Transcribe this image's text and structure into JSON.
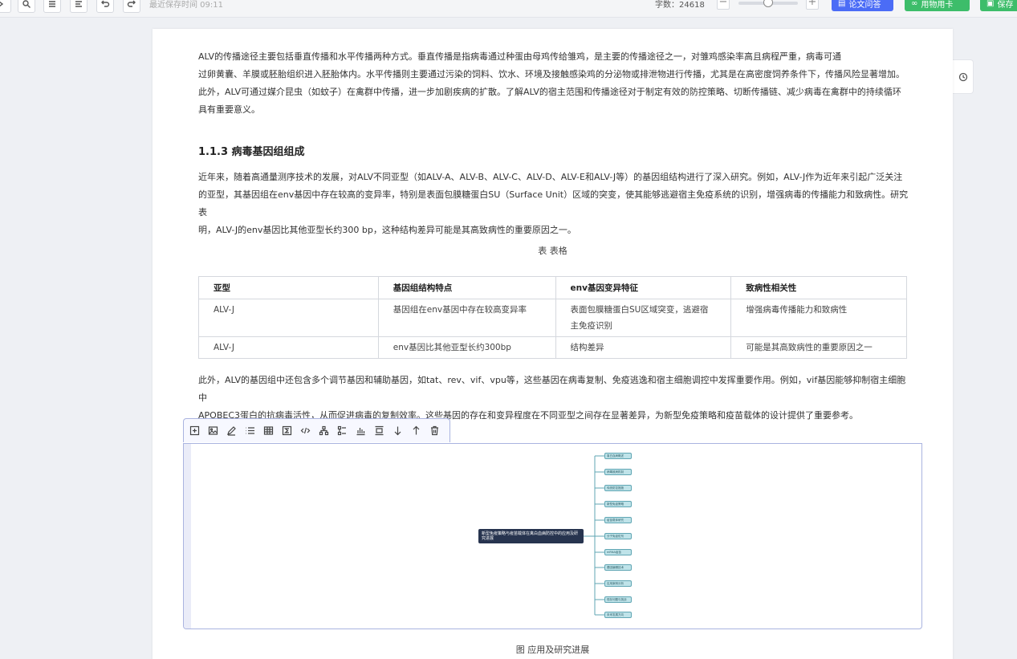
{
  "toolbar": {
    "save_time": "最近保存时间 09:11",
    "word_count": "字数：24618",
    "qa_label": "论文问答",
    "card_label": "用物用卡",
    "save_label": "保存"
  },
  "document": {
    "intro_clipped": "ALV的传播途径主要包括垂直传播和水平传播两种方式。垂直传播是指病毒通过种蛋由母鸡传给雏鸡，是主要的传播途径之一，对雏鸡感染率高且病程严重，病毒可通",
    "intro_lines": [
      "过卵黄囊、羊膜或胚胎组织进入胚胎体内。水平传播则主要通过污染的饲料、饮水、环境及接触感染鸡的分泌物或排泄物进行传播，尤其是在高密度饲养条件下，传播风险显著增加。",
      "此外，ALV可通过媒介昆虫（如蚊子）在禽群中传播，进一步加剧疾病的扩散。了解ALV的宿主范围和传播途径对于制定有效的防控策略、切断传播链、减少病毒在禽群中的持续循环",
      "具有重要意义。"
    ],
    "section_heading": "1.1.3 病毒基因组组成",
    "genome_lines": [
      "近年来，随着高通量测序技术的发展，对ALV不同亚型（如ALV-A、ALV-B、ALV-C、ALV-D、ALV-E和ALV-J等）的基因组结构进行了深入研究。例如，ALV-J作为近年来引起广泛关注",
      "的亚型，其基因组在env基因中存在较高的变异率，特别是表面包膜糖蛋白SU（Surface Unit）区域的突变，使其能够逃避宿主免疫系统的识别，增强病毒的传播能力和致病性。研究表",
      "明，ALV-J的env基因比其他亚型长约300 bp，这种结构差异可能是其高致病性的重要原因之一。"
    ],
    "table_caption": "表  表格",
    "table": {
      "headers": [
        "亚型",
        "基因组结构特点",
        "env基因变异特征",
        "致病性相关性"
      ],
      "rows": [
        [
          "ALV-J",
          "基因组在env基因中存在较高变异率",
          "表面包膜糖蛋白SU区域突变，逃避宿主免疫识别",
          "增强病毒传播能力和致病性"
        ],
        [
          "ALV-J",
          "env基因比其他亚型长约300bp",
          "结构差异",
          "可能是其高致病性的重要原因之一"
        ]
      ]
    },
    "regulatory_lines": [
      "此外，ALV的基因组中还包含多个调节基因和辅助基因，如tat、rev、vif、vpu等，这些基因在病毒复制、免疫逃逸和宿主细胞调控中发挥重要作用。例如，vif基因能够抑制宿主细胞中",
      "APOBEC3蛋白的抗病毒活性，从而促进病毒的复制效率。这些基因的存在和变异程度在不同亚型之间存在显著差异，为新型免疫策略和疫苗载体的设计提供了重要参考。"
    ],
    "mindmap": {
      "root": "新型免疫策略与疫苗载体在禽白血病防控中的应用及研究进展",
      "children": [
        "禽白血病概述",
        "病毒致病机制",
        "传统防控措施",
        "新型免疫策略",
        "疫苗载体研究",
        "分子免疫佐剂",
        "mRNA疫苗",
        "基因编辑技术",
        "应用案例分析",
        "现存问题与挑战",
        "未来发展方向"
      ]
    },
    "figure_caption": "图  应用及研究进展"
  }
}
